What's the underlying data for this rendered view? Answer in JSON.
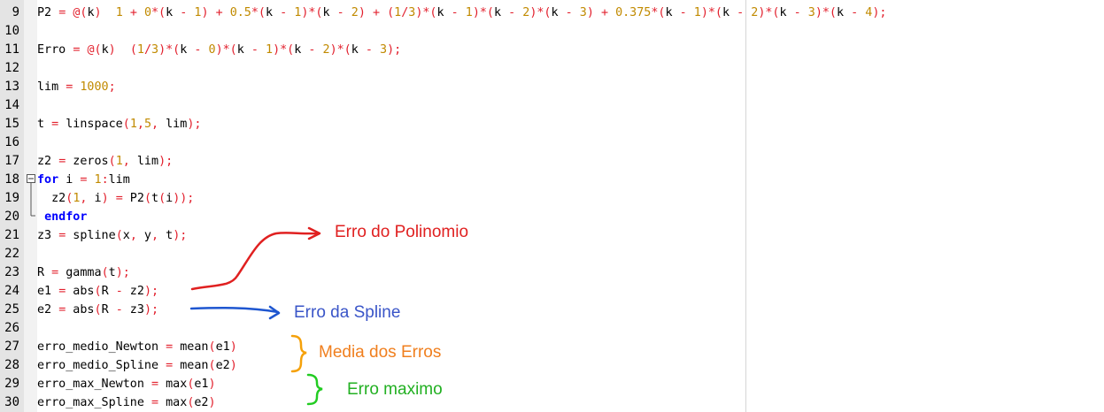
{
  "editor": {
    "lines": [
      {
        "n": "9",
        "segs": [
          [
            "P2 ",
            "t"
          ],
          [
            "=",
            "o"
          ],
          [
            " ",
            "t"
          ],
          [
            "@(",
            "o"
          ],
          [
            "k",
            "t"
          ],
          [
            ")",
            "o"
          ],
          [
            "  ",
            "t"
          ],
          [
            "1",
            "n"
          ],
          [
            " ",
            "t"
          ],
          [
            "+",
            "o"
          ],
          [
            " ",
            "t"
          ],
          [
            "0",
            "n"
          ],
          [
            "*(",
            "o"
          ],
          [
            "k ",
            "t"
          ],
          [
            "-",
            "o"
          ],
          [
            " ",
            "t"
          ],
          [
            "1",
            "n"
          ],
          [
            ")",
            "o"
          ],
          [
            " ",
            "t"
          ],
          [
            "+",
            "o"
          ],
          [
            " ",
            "t"
          ],
          [
            "0.5",
            "n"
          ],
          [
            "*(",
            "o"
          ],
          [
            "k ",
            "t"
          ],
          [
            "-",
            "o"
          ],
          [
            " ",
            "t"
          ],
          [
            "1",
            "n"
          ],
          [
            ")*(",
            "o"
          ],
          [
            "k ",
            "t"
          ],
          [
            "-",
            "o"
          ],
          [
            " ",
            "t"
          ],
          [
            "2",
            "n"
          ],
          [
            ")",
            "o"
          ],
          [
            " ",
            "t"
          ],
          [
            "+",
            "o"
          ],
          [
            " ",
            "t"
          ],
          [
            "(",
            "o"
          ],
          [
            "1",
            "n"
          ],
          [
            "/",
            "o"
          ],
          [
            "3",
            "n"
          ],
          [
            ")*(",
            "o"
          ],
          [
            "k ",
            "t"
          ],
          [
            "-",
            "o"
          ],
          [
            " ",
            "t"
          ],
          [
            "1",
            "n"
          ],
          [
            ")*(",
            "o"
          ],
          [
            "k ",
            "t"
          ],
          [
            "-",
            "o"
          ],
          [
            " ",
            "t"
          ],
          [
            "2",
            "n"
          ],
          [
            ")*(",
            "o"
          ],
          [
            "k ",
            "t"
          ],
          [
            "-",
            "o"
          ],
          [
            " ",
            "t"
          ],
          [
            "3",
            "n"
          ],
          [
            ")",
            "o"
          ],
          [
            " ",
            "t"
          ],
          [
            "+",
            "o"
          ],
          [
            " ",
            "t"
          ],
          [
            "0.375",
            "n"
          ],
          [
            "*(",
            "o"
          ],
          [
            "k ",
            "t"
          ],
          [
            "-",
            "o"
          ],
          [
            " ",
            "t"
          ],
          [
            "1",
            "n"
          ],
          [
            ")*(",
            "o"
          ],
          [
            "k ",
            "t"
          ],
          [
            "-",
            "o"
          ],
          [
            " ",
            "t"
          ],
          [
            "2",
            "n"
          ],
          [
            ")*(",
            "o"
          ],
          [
            "k ",
            "t"
          ],
          [
            "-",
            "o"
          ],
          [
            " ",
            "t"
          ],
          [
            "3",
            "n"
          ],
          [
            ")*(",
            "o"
          ],
          [
            "k ",
            "t"
          ],
          [
            "-",
            "o"
          ],
          [
            " ",
            "t"
          ],
          [
            "4",
            "n"
          ],
          [
            ");",
            "o"
          ]
        ]
      },
      {
        "n": "10",
        "segs": []
      },
      {
        "n": "11",
        "segs": [
          [
            "Erro ",
            "t"
          ],
          [
            "=",
            "o"
          ],
          [
            " ",
            "t"
          ],
          [
            "@(",
            "o"
          ],
          [
            "k",
            "t"
          ],
          [
            ")",
            "o"
          ],
          [
            "  ",
            "t"
          ],
          [
            "(",
            "o"
          ],
          [
            "1",
            "n"
          ],
          [
            "/",
            "o"
          ],
          [
            "3",
            "n"
          ],
          [
            ")*(",
            "o"
          ],
          [
            "k ",
            "t"
          ],
          [
            "-",
            "o"
          ],
          [
            " ",
            "t"
          ],
          [
            "0",
            "n"
          ],
          [
            ")*(",
            "o"
          ],
          [
            "k ",
            "t"
          ],
          [
            "-",
            "o"
          ],
          [
            " ",
            "t"
          ],
          [
            "1",
            "n"
          ],
          [
            ")*(",
            "o"
          ],
          [
            "k ",
            "t"
          ],
          [
            "-",
            "o"
          ],
          [
            " ",
            "t"
          ],
          [
            "2",
            "n"
          ],
          [
            ")*(",
            "o"
          ],
          [
            "k ",
            "t"
          ],
          [
            "-",
            "o"
          ],
          [
            " ",
            "t"
          ],
          [
            "3",
            "n"
          ],
          [
            ");",
            "o"
          ]
        ]
      },
      {
        "n": "12",
        "segs": []
      },
      {
        "n": "13",
        "segs": [
          [
            "lim ",
            "t"
          ],
          [
            "=",
            "o"
          ],
          [
            " ",
            "t"
          ],
          [
            "1000",
            "n"
          ],
          [
            ";",
            "o"
          ]
        ]
      },
      {
        "n": "14",
        "segs": []
      },
      {
        "n": "15",
        "segs": [
          [
            "t ",
            "t"
          ],
          [
            "=",
            "o"
          ],
          [
            " linspace",
            "t"
          ],
          [
            "(",
            "o"
          ],
          [
            "1",
            "n"
          ],
          [
            ",",
            "o"
          ],
          [
            "5",
            "n"
          ],
          [
            ",",
            "o"
          ],
          [
            " lim",
            "t"
          ],
          [
            ");",
            "o"
          ]
        ]
      },
      {
        "n": "16",
        "segs": []
      },
      {
        "n": "17",
        "segs": [
          [
            "z2 ",
            "t"
          ],
          [
            "=",
            "o"
          ],
          [
            " zeros",
            "t"
          ],
          [
            "(",
            "o"
          ],
          [
            "1",
            "n"
          ],
          [
            ",",
            "o"
          ],
          [
            " lim",
            "t"
          ],
          [
            ");",
            "o"
          ]
        ]
      },
      {
        "n": "18",
        "segs": [
          [
            "for",
            "k"
          ],
          [
            " i ",
            "t"
          ],
          [
            "=",
            "o"
          ],
          [
            " ",
            "t"
          ],
          [
            "1",
            "n"
          ],
          [
            ":",
            "o"
          ],
          [
            "lim",
            "t"
          ]
        ]
      },
      {
        "n": "19",
        "segs": [
          [
            "  z2",
            "t"
          ],
          [
            "(",
            "o"
          ],
          [
            "1",
            "n"
          ],
          [
            ",",
            "o"
          ],
          [
            " i",
            "t"
          ],
          [
            ")",
            "o"
          ],
          [
            " ",
            "t"
          ],
          [
            "=",
            "o"
          ],
          [
            " P2",
            "t"
          ],
          [
            "(",
            "o"
          ],
          [
            "t",
            "t"
          ],
          [
            "(",
            "o"
          ],
          [
            "i",
            "t"
          ],
          [
            "));",
            "o"
          ]
        ]
      },
      {
        "n": "20",
        "segs": [
          [
            " ",
            "t"
          ],
          [
            "endfor",
            "k"
          ]
        ]
      },
      {
        "n": "21",
        "segs": [
          [
            "z3 ",
            "t"
          ],
          [
            "=",
            "o"
          ],
          [
            " spline",
            "t"
          ],
          [
            "(",
            "o"
          ],
          [
            "x",
            "t"
          ],
          [
            ",",
            "o"
          ],
          [
            " y",
            "t"
          ],
          [
            ",",
            "o"
          ],
          [
            " t",
            "t"
          ],
          [
            ");",
            "o"
          ]
        ]
      },
      {
        "n": "22",
        "segs": []
      },
      {
        "n": "23",
        "segs": [
          [
            "R ",
            "t"
          ],
          [
            "=",
            "o"
          ],
          [
            " gamma",
            "t"
          ],
          [
            "(",
            "o"
          ],
          [
            "t",
            "t"
          ],
          [
            ");",
            "o"
          ]
        ]
      },
      {
        "n": "24",
        "segs": [
          [
            "e1 ",
            "t"
          ],
          [
            "=",
            "o"
          ],
          [
            " abs",
            "t"
          ],
          [
            "(",
            "o"
          ],
          [
            "R ",
            "t"
          ],
          [
            "-",
            "o"
          ],
          [
            " z2",
            "t"
          ],
          [
            ");",
            "o"
          ]
        ]
      },
      {
        "n": "25",
        "segs": [
          [
            "e2 ",
            "t"
          ],
          [
            "=",
            "o"
          ],
          [
            " abs",
            "t"
          ],
          [
            "(",
            "o"
          ],
          [
            "R ",
            "t"
          ],
          [
            "-",
            "o"
          ],
          [
            " z3",
            "t"
          ],
          [
            ");",
            "o"
          ]
        ]
      },
      {
        "n": "26",
        "segs": []
      },
      {
        "n": "27",
        "segs": [
          [
            "erro_medio_Newton ",
            "t"
          ],
          [
            "=",
            "o"
          ],
          [
            " mean",
            "t"
          ],
          [
            "(",
            "o"
          ],
          [
            "e1",
            "t"
          ],
          [
            ")",
            "o"
          ]
        ]
      },
      {
        "n": "28",
        "segs": [
          [
            "erro_medio_Spline ",
            "t"
          ],
          [
            "=",
            "o"
          ],
          [
            " mean",
            "t"
          ],
          [
            "(",
            "o"
          ],
          [
            "e2",
            "t"
          ],
          [
            ")",
            "o"
          ]
        ]
      },
      {
        "n": "29",
        "segs": [
          [
            "erro_max_Newton ",
            "t"
          ],
          [
            "=",
            "o"
          ],
          [
            " max",
            "t"
          ],
          [
            "(",
            "o"
          ],
          [
            "e1",
            "t"
          ],
          [
            ")",
            "o"
          ]
        ]
      },
      {
        "n": "30",
        "segs": [
          [
            "erro_max_Spline ",
            "t"
          ],
          [
            "=",
            "o"
          ],
          [
            " max",
            "t"
          ],
          [
            "(",
            "o"
          ],
          [
            "e2",
            "t"
          ],
          [
            ")",
            "o"
          ]
        ]
      }
    ]
  },
  "annotations": {
    "polinomio": {
      "text": "Erro do Polinomio",
      "color": "#e02020"
    },
    "spline": {
      "text": "Erro da Spline",
      "color": "#3a55c8"
    },
    "media": {
      "text": "Media dos Erros",
      "color": "#f07f1e"
    },
    "maximo": {
      "text": "Erro maximo",
      "color": "#22b022"
    }
  },
  "colors": {
    "number": "#c18a00",
    "operator": "#e2202d",
    "keyword": "#0000ff",
    "text": "#000000"
  }
}
